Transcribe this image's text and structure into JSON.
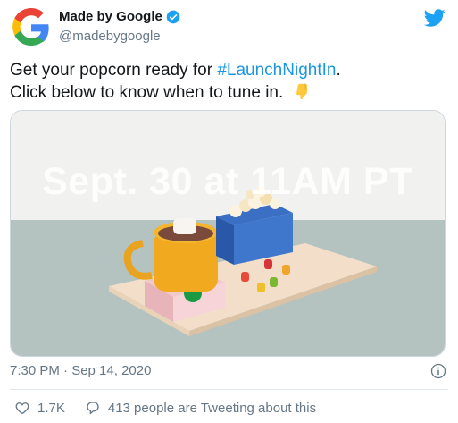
{
  "author": {
    "name": "Made by Google",
    "handle": "@madebygoogle",
    "verified": true
  },
  "tweet": {
    "line1_prefix": "Get your popcorn ready for ",
    "hashtag": "#LaunchNightIn",
    "line1_suffix": ".",
    "line2": "Click below to know when to tune in.",
    "emoji": "pointing-down-hand-icon"
  },
  "media": {
    "title": "Sept. 30 at 11AM PT"
  },
  "meta": {
    "timestamp": "7:30 PM · Sep 14, 2020"
  },
  "stats": {
    "likes": "1.7K",
    "tweeting": "413 people are Tweeting about this"
  },
  "colors": {
    "link": "#1b95e0",
    "secondary_text": "#657786",
    "twitter_blue": "#1da1f2"
  }
}
